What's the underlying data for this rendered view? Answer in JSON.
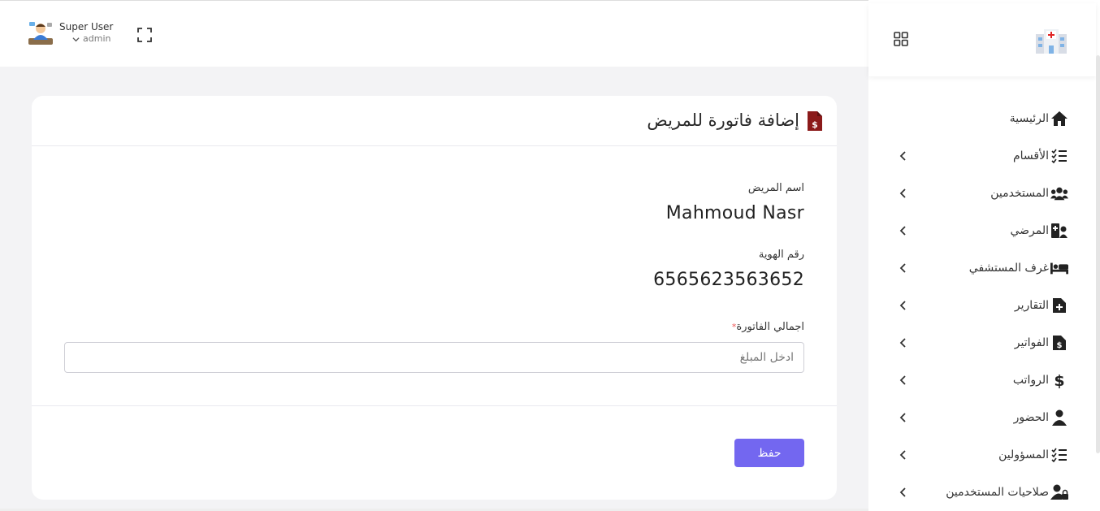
{
  "header": {
    "user_name": "Super User",
    "user_role": "admin",
    "icons": [
      "avatar",
      "chevron-down-icon",
      "fullscreen-icon"
    ]
  },
  "sidebar": {
    "header_icons": [
      "grid-icon",
      "hospital-logo"
    ],
    "items": [
      {
        "label": "الرئيسية",
        "icon": "home-icon",
        "has_children": false
      },
      {
        "label": "الأقسام",
        "icon": "checklist-icon",
        "has_children": true
      },
      {
        "label": "المستخدمين",
        "icon": "users-icon",
        "has_children": true
      },
      {
        "label": "المرضي",
        "icon": "patient-icon",
        "has_children": true
      },
      {
        "label": "غرف المستشفي",
        "icon": "bed-icon",
        "has_children": true
      },
      {
        "label": "التقارير",
        "icon": "file-medical-icon",
        "has_children": true
      },
      {
        "label": "الفواتير",
        "icon": "invoice-icon",
        "has_children": true
      },
      {
        "label": "الرواتب",
        "icon": "dollar-icon",
        "has_children": true
      },
      {
        "label": "الحضور",
        "icon": "user-icon",
        "has_children": true
      },
      {
        "label": "المسؤولين",
        "icon": "checklist-icon",
        "has_children": true
      },
      {
        "label": "صلاحيات المستخدمين",
        "icon": "user-lock-icon",
        "has_children": true
      }
    ]
  },
  "card": {
    "title": "إضافة فاتورة للمريض",
    "patient_name_label": "اسم المريض",
    "patient_name": "Mahmoud Nasr",
    "id_label": "رقم الهوية",
    "id_value": "6565623563652",
    "total_label": "اجمالي الفاتورة",
    "total_required_mark": "*",
    "total_placeholder": "ادخل المبلغ",
    "total_value": "",
    "save_label": "حفظ"
  },
  "colors": {
    "primary": "#7367f0",
    "invoice_icon": "#8b1a1a",
    "background": "#f3f3f5"
  }
}
